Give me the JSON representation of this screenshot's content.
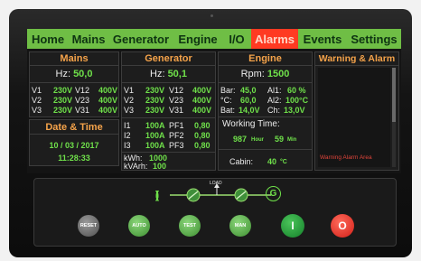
{
  "nav": {
    "tabs": [
      {
        "label": "Home",
        "active": false
      },
      {
        "label": "Mains",
        "active": false
      },
      {
        "label": "Generator",
        "active": false
      },
      {
        "label": "Engine",
        "active": false
      },
      {
        "label": "I/O",
        "active": false
      },
      {
        "label": "Alarms",
        "active": true
      },
      {
        "label": "Events",
        "active": false
      },
      {
        "label": "Settings",
        "active": false
      }
    ]
  },
  "mains": {
    "title": "Mains",
    "hz_label": "Hz:",
    "hz_value": "50,0",
    "phase_volts": [
      {
        "label": "V1",
        "value": "230V"
      },
      {
        "label": "V2",
        "value": "230V"
      },
      {
        "label": "V3",
        "value": "230V"
      }
    ],
    "line_volts": [
      {
        "label": "V12",
        "value": "400V"
      },
      {
        "label": "V23",
        "value": "400V"
      },
      {
        "label": "V31",
        "value": "400V"
      }
    ]
  },
  "datetime": {
    "title": "Date & Time",
    "date": "10 / 03 / 2017",
    "time": "11:28:33"
  },
  "generator": {
    "title": "Generator",
    "hz_label": "Hz:",
    "hz_value": "50,1",
    "phase_volts": [
      {
        "label": "V1",
        "value": "230V"
      },
      {
        "label": "V2",
        "value": "230V"
      },
      {
        "label": "V3",
        "value": "230V"
      }
    ],
    "line_volts": [
      {
        "label": "V12",
        "value": "400V"
      },
      {
        "label": "V23",
        "value": "400V"
      },
      {
        "label": "V31",
        "value": "400V"
      }
    ],
    "currents": [
      {
        "label": "I1",
        "value": "100A"
      },
      {
        "label": "I2",
        "value": "100A"
      },
      {
        "label": "I3",
        "value": "100A"
      }
    ],
    "power_factors": [
      {
        "label": "PF1",
        "value": "0,80"
      },
      {
        "label": "PF2",
        "value": "0,80"
      },
      {
        "label": "PF3",
        "value": "0,80"
      }
    ],
    "kwh_label": "kWh:",
    "kwh_value": "1000",
    "kvarh_label": "kVArh:",
    "kvarh_value": "100"
  },
  "engine": {
    "title": "Engine",
    "rpm_label": "Rpm:",
    "rpm_value": "1500",
    "bar_label": "Bar:",
    "bar_value": "45,0",
    "al1_label": "Al1:",
    "al1_value": "60 %",
    "c_label": "°C:",
    "c_value": "60,0",
    "al2_label": "Al2:",
    "al2_value": "100°C",
    "bat_label": "Bat:",
    "bat_value": "14,0V",
    "ch_label": "Ch:",
    "ch_value": "13,0V",
    "working_time_label": "Working Time:",
    "hours_value": "987",
    "hours_unit": "Hour",
    "minutes_value": "59",
    "minutes_unit": "Min",
    "cabin_label": "Cabin:",
    "cabin_value": "40",
    "cabin_unit": "°C"
  },
  "warning": {
    "title": "Warning & Alarm",
    "area_text": "Warning Alarm Area"
  },
  "control": {
    "load_label": "LOAD",
    "mains_symbol": "(())",
    "gen_symbol": "G",
    "buttons": {
      "reset": "RESET",
      "auto": "AUTO",
      "test": "TEST",
      "man": "MAN",
      "on": "I",
      "off": "O"
    }
  },
  "colors": {
    "nav_green": "#6fbe45",
    "alarm_red": "#ff3a22",
    "value_green": "#6fe04a",
    "title_orange": "#f5a34a",
    "warning_red": "#e0443a"
  }
}
